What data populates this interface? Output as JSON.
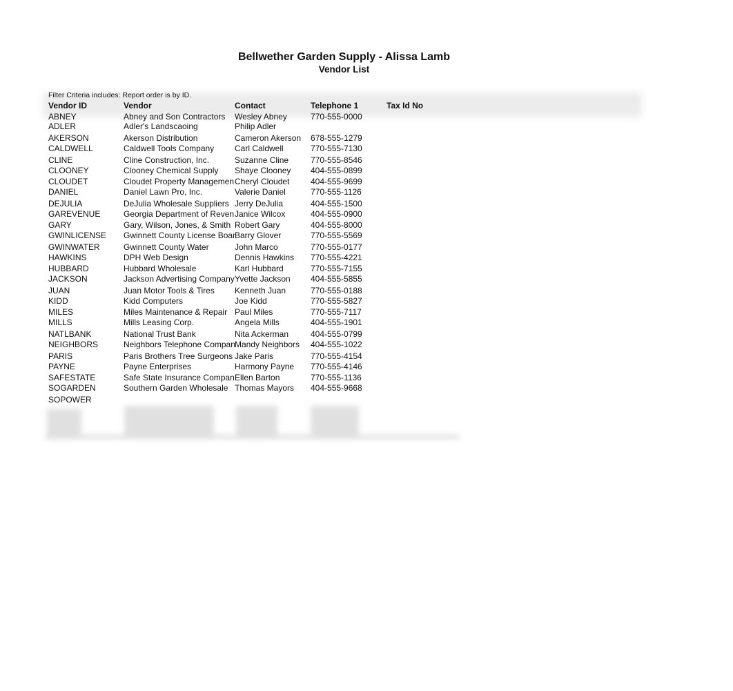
{
  "report": {
    "title": "Bellwether Garden Supply - Alissa Lamb",
    "subtitle": "Vendor List",
    "filter_criteria": "Filter Criteria includes: Report order is by ID."
  },
  "columns": {
    "vendor_id": "Vendor ID",
    "vendor": "Vendor",
    "contact": "Contact",
    "telephone": "Telephone 1",
    "tax_id": "Tax Id No"
  },
  "rows": [
    {
      "id": "ABNEY",
      "vendor": "Abney and Son Contractors",
      "contact": "Wesley Abney",
      "phone": "770-555-0000",
      "tax": ""
    },
    {
      "id": "ADLER",
      "vendor": "Adler's Landscaoing",
      "contact": "Philip Adler",
      "phone": "",
      "tax": ""
    },
    {
      "id": "AKERSON",
      "vendor": "Akerson Distribution",
      "contact": "Cameron Akerson",
      "phone": "678-555-1279",
      "tax": ""
    },
    {
      "id": "CALDWELL",
      "vendor": "Caldwell Tools Company",
      "contact": "Carl Caldwell",
      "phone": "770-555-7130",
      "tax": ""
    },
    {
      "id": "CLINE",
      "vendor": "Cline Construction, Inc.",
      "contact": "Suzanne Cline",
      "phone": "770-555-8546",
      "tax": ""
    },
    {
      "id": "CLOONEY",
      "vendor": "Clooney Chemical Supply",
      "contact": "Shaye Clooney",
      "phone": "404-555-0899",
      "tax": ""
    },
    {
      "id": "CLOUDET",
      "vendor": "Cloudet Property Managemen",
      "contact": "Cheryl Cloudet",
      "phone": "404-555-9699",
      "tax": ""
    },
    {
      "id": "DANIEL",
      "vendor": "Daniel Lawn Pro, Inc.",
      "contact": "Valerie Daniel",
      "phone": "770-555-1126",
      "tax": ""
    },
    {
      "id": "DEJULIA",
      "vendor": "DeJulia Wholesale Suppliers",
      "contact": "Jerry DeJulia",
      "phone": "404-555-1500",
      "tax": ""
    },
    {
      "id": "GAREVENUE",
      "vendor": "Georgia Department of Reven",
      "contact": "Janice Wilcox",
      "phone": "404-555-0900",
      "tax": ""
    },
    {
      "id": "GARY",
      "vendor": "Gary, Wilson, Jones, & Smith",
      "contact": "Robert Gary",
      "phone": "404-555-8000",
      "tax": ""
    },
    {
      "id": "GWINLICENSE",
      "vendor": "Gwinnett County License Boar",
      "contact": "Barry Glover",
      "phone": "770-555-5569",
      "tax": ""
    },
    {
      "id": "GWINWATER",
      "vendor": "Gwinnett County Water",
      "contact": "John Marco",
      "phone": "770-555-0177",
      "tax": ""
    },
    {
      "id": "HAWKINS",
      "vendor": "DPH Web Design",
      "contact": "Dennis Hawkins",
      "phone": "770-555-4221",
      "tax": ""
    },
    {
      "id": "HUBBARD",
      "vendor": "Hubbard Wholesale",
      "contact": "Karl Hubbard",
      "phone": "770-555-7155",
      "tax": ""
    },
    {
      "id": "JACKSON",
      "vendor": "Jackson Advertising Company",
      "contact": "Yvette Jackson",
      "phone": "404-555-5855",
      "tax": ""
    },
    {
      "id": "JUAN",
      "vendor": "Juan Motor Tools & Tires",
      "contact": "Kenneth Juan",
      "phone": "770-555-0188",
      "tax": ""
    },
    {
      "id": "KIDD",
      "vendor": "Kidd Computers",
      "contact": "Joe Kidd",
      "phone": "770-555-5827",
      "tax": ""
    },
    {
      "id": "MILES",
      "vendor": "Miles Maintenance & Repair",
      "contact": "Paul Miles",
      "phone": "770-555-7117",
      "tax": ""
    },
    {
      "id": "MILLS",
      "vendor": "Mills Leasing Corp.",
      "contact": "Angela Mills",
      "phone": "404-555-1901",
      "tax": ""
    },
    {
      "id": "NATLBANK",
      "vendor": "National Trust Bank",
      "contact": "Nita Ackerman",
      "phone": "404-555-0799",
      "tax": ""
    },
    {
      "id": "NEIGHBORS",
      "vendor": "Neighbors Telephone Compan",
      "contact": "Mandy Neighbors",
      "phone": "404-555-1022",
      "tax": ""
    },
    {
      "id": "PARIS",
      "vendor": "Paris Brothers Tree Surgeons",
      "contact": "Jake Paris",
      "phone": "770-555-4154",
      "tax": ""
    },
    {
      "id": "PAYNE",
      "vendor": "Payne Enterprises",
      "contact": "Harmony Payne",
      "phone": "770-555-4146",
      "tax": ""
    },
    {
      "id": "SAFESTATE",
      "vendor": "Safe State Insurance Compan",
      "contact": "Ellen Barton",
      "phone": "770-555-1136",
      "tax": ""
    },
    {
      "id": "SOGARDEN",
      "vendor": "Southern Garden Wholesale",
      "contact": "Thomas Mayors",
      "phone": "404-555-9668",
      "tax": ""
    },
    {
      "id": "SOPOWER",
      "vendor": "",
      "contact": "",
      "phone": "",
      "tax": ""
    }
  ]
}
